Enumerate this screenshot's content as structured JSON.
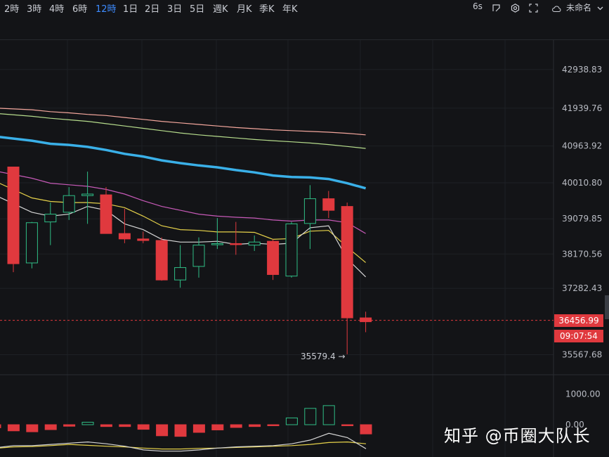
{
  "toolbar": {
    "timeframes": [
      {
        "label": "2時",
        "active": false
      },
      {
        "label": "3時",
        "active": false
      },
      {
        "label": "4時",
        "active": false
      },
      {
        "label": "6時",
        "active": false
      },
      {
        "label": "12時",
        "active": true
      },
      {
        "label": "1日",
        "active": false
      },
      {
        "label": "2日",
        "active": false
      },
      {
        "label": "3日",
        "active": false
      },
      {
        "label": "5日",
        "active": false
      },
      {
        "label": "週K",
        "active": false
      },
      {
        "label": "月K",
        "active": false
      },
      {
        "label": "季K",
        "active": false
      },
      {
        "label": "年K",
        "active": false
      }
    ],
    "refresh": "6s",
    "layout_name": "未命名",
    "icons": [
      "draw-icon",
      "settings-icon",
      "fullscreen-icon",
      "cloud-icon",
      "chevron-down-icon"
    ]
  },
  "chart_data": [
    {
      "type": "candlestick",
      "y_ticks": [
        "42938.83",
        "41939.76",
        "40963.92",
        "40010.80",
        "39079.85",
        "38170.56",
        "37282.43",
        "35567.68"
      ],
      "ylim": [
        35050,
        43700
      ],
      "candles": [
        {
          "o": 40420,
          "h": 40420,
          "l": 37700,
          "c": 37920
        },
        {
          "o": 37940,
          "h": 39000,
          "l": 37800,
          "c": 38980
        },
        {
          "o": 39000,
          "h": 39500,
          "l": 38400,
          "c": 39200
        },
        {
          "o": 39250,
          "h": 39900,
          "l": 39050,
          "c": 39680
        },
        {
          "o": 39680,
          "h": 40300,
          "l": 38950,
          "c": 39720
        },
        {
          "o": 39700,
          "h": 39900,
          "l": 38700,
          "c": 38700
        },
        {
          "o": 38700,
          "h": 39340,
          "l": 38450,
          "c": 38560
        },
        {
          "o": 38560,
          "h": 38750,
          "l": 38450,
          "c": 38520
        },
        {
          "o": 38520,
          "h": 38600,
          "l": 37480,
          "c": 37500
        },
        {
          "o": 37500,
          "h": 38400,
          "l": 37300,
          "c": 37820
        },
        {
          "o": 37850,
          "h": 38600,
          "l": 37560,
          "c": 38400
        },
        {
          "o": 38410,
          "h": 39100,
          "l": 38300,
          "c": 38440
        },
        {
          "o": 38440,
          "h": 39000,
          "l": 38150,
          "c": 38420
        },
        {
          "o": 38400,
          "h": 38650,
          "l": 38250,
          "c": 38480
        },
        {
          "o": 38500,
          "h": 38550,
          "l": 37500,
          "c": 37640
        },
        {
          "o": 37600,
          "h": 39000,
          "l": 37560,
          "c": 38950
        },
        {
          "o": 38960,
          "h": 39950,
          "l": 38300,
          "c": 39600
        },
        {
          "o": 39600,
          "h": 39800,
          "l": 39100,
          "c": 39300
        },
        {
          "o": 39400,
          "h": 39500,
          "l": 35579.4,
          "c": 36520
        },
        {
          "o": 36520,
          "h": 36680,
          "l": 36150,
          "c": 36420
        }
      ],
      "moving_averages": [
        {
          "color": "#f4a79d",
          "values": [
            41940,
            41900,
            41850,
            41820,
            41780,
            41750,
            41700,
            41650,
            41600,
            41560,
            41520,
            41480,
            41440,
            41410,
            41380,
            41360,
            41340,
            41320,
            41290,
            41250
          ]
        },
        {
          "color": "#b6dc8c",
          "values": [
            41800,
            41730,
            41680,
            41640,
            41600,
            41540,
            41480,
            41420,
            41360,
            41300,
            41250,
            41210,
            41170,
            41130,
            41100,
            41070,
            41040,
            41000,
            40950,
            40900
          ]
        },
        {
          "color": "#3ab0e8",
          "values": [
            41200,
            41100,
            41020,
            40990,
            40940,
            40860,
            40760,
            40690,
            40590,
            40520,
            40460,
            40410,
            40340,
            40280,
            40200,
            40160,
            40150,
            40110,
            40000,
            39870
          ]
        },
        {
          "color": "#c75ab8",
          "values": [
            40300,
            40130,
            40000,
            39960,
            39920,
            39840,
            39720,
            39550,
            39400,
            39300,
            39200,
            39150,
            39120,
            39100,
            39050,
            39020,
            39050,
            39050,
            38980,
            38700
          ]
        },
        {
          "color": "#e6d24a",
          "values": [
            40010,
            39620,
            39530,
            39500,
            39500,
            39470,
            39370,
            39150,
            38900,
            38800,
            38780,
            38740,
            38740,
            38730,
            38550,
            38570,
            38760,
            38780,
            38350,
            37950
          ]
        },
        {
          "color": "#d6d6d6",
          "values": [
            39650,
            39250,
            39150,
            39200,
            39400,
            39300,
            38950,
            38800,
            38550,
            38480,
            38480,
            38500,
            38420,
            38450,
            38420,
            38450,
            38850,
            38900,
            38050,
            37580
          ]
        }
      ],
      "last_price": "36456.99",
      "countdown": "09:07:54",
      "low_label": "35579.4"
    },
    {
      "type": "bar",
      "y_ticks": [
        "1000.00",
        "0.00"
      ],
      "ylim": [
        -1050,
        1600
      ],
      "values": [
        -100,
        -200,
        -230,
        -160,
        -50,
        80,
        -60,
        -60,
        -150,
        -360,
        -380,
        -250,
        -170,
        -90,
        -60,
        -30,
        220,
        530,
        620,
        -20,
        -300
      ],
      "lines": [
        {
          "color": "#e6d24a",
          "values": [
            -760,
            -720,
            -710,
            -680,
            -640,
            -670,
            -700,
            -720,
            -760,
            -790,
            -790,
            -770,
            -760,
            -740,
            -720,
            -700,
            -680,
            -640,
            -580,
            -560,
            -620
          ]
        },
        {
          "color": "#d6d6d6",
          "values": [
            -740,
            -680,
            -680,
            -640,
            -600,
            -560,
            -620,
            -700,
            -820,
            -860,
            -860,
            -820,
            -760,
            -720,
            -700,
            -680,
            -620,
            -500,
            -280,
            -420,
            -780
          ]
        }
      ]
    }
  ],
  "watermark": "知乎 @币圈大队长"
}
